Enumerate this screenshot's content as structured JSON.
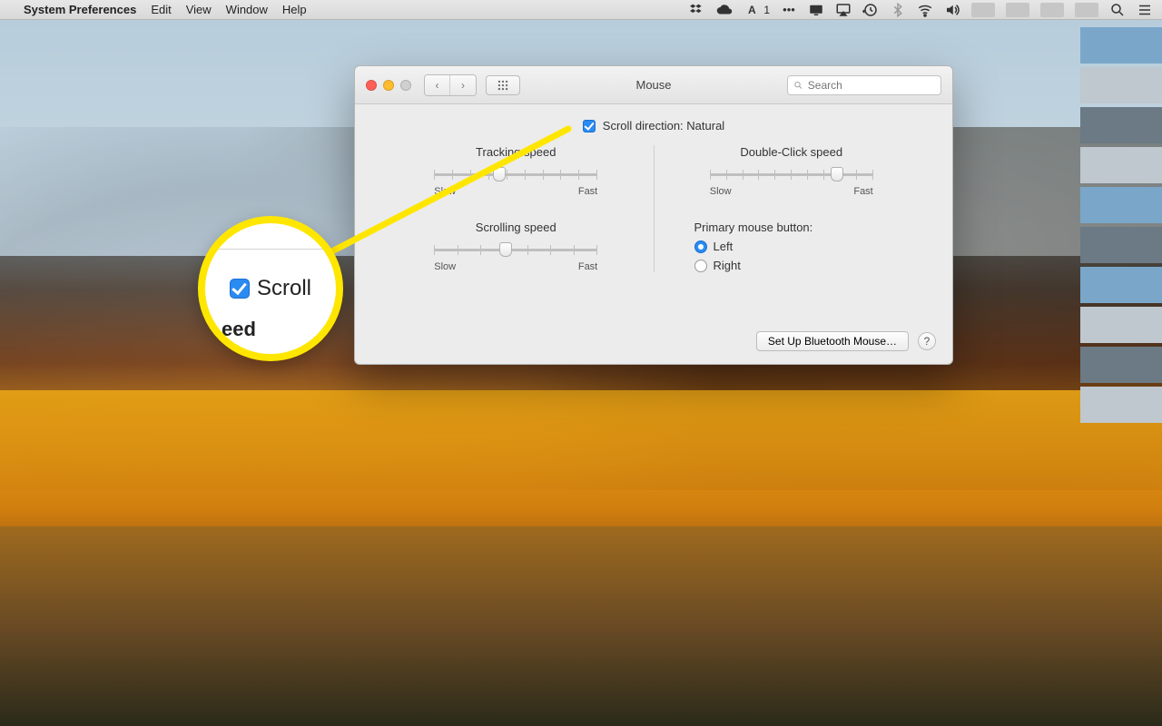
{
  "menubar": {
    "app_name": "System Preferences",
    "items": [
      "Edit",
      "View",
      "Window",
      "Help"
    ],
    "right_text": "1"
  },
  "window": {
    "title": "Mouse",
    "search_placeholder": "Search",
    "scroll_direction_label": "Scroll direction: Natural",
    "tracking": {
      "title": "Tracking speed",
      "low": "Slow",
      "high": "Fast"
    },
    "scrolling": {
      "title": "Scrolling speed",
      "low": "Slow",
      "high": "Fast"
    },
    "doubleclick": {
      "title": "Double-Click speed",
      "low": "Slow",
      "high": "Fast"
    },
    "primary": {
      "title": "Primary mouse button:",
      "left": "Left",
      "right": "Right"
    },
    "bluetooth_btn": "Set Up Bluetooth Mouse…",
    "help": "?"
  },
  "callout": {
    "main": "Scroll",
    "fragment": "eed"
  }
}
